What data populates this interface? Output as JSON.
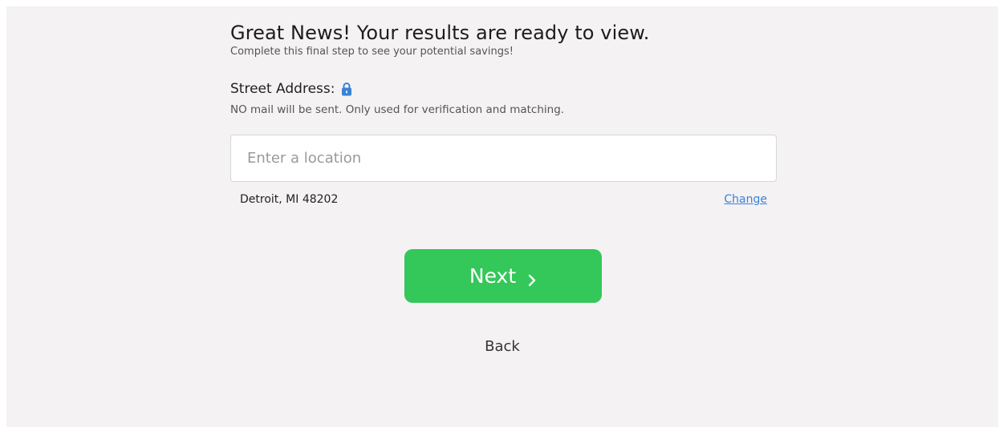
{
  "form": {
    "headline": "Great News! Your results are ready to view.",
    "subhead": "Complete this final step to see your potential savings!",
    "address_label": "Street Address:",
    "address_note": "NO mail will be sent. Only used for verification and matching.",
    "address_placeholder": "Enter a location",
    "address_value": "",
    "location_text": "Detroit, MI 48202",
    "change_label": "Change"
  },
  "actions": {
    "next_label": "Next",
    "back_label": "Back"
  },
  "icons": {
    "lock": "lock-icon",
    "next": "chevron-right-icon"
  },
  "colors": {
    "background": "#f4f2f3",
    "next_button": "#34c759",
    "link": "#3b82d6",
    "lock": "#3b82d6"
  }
}
